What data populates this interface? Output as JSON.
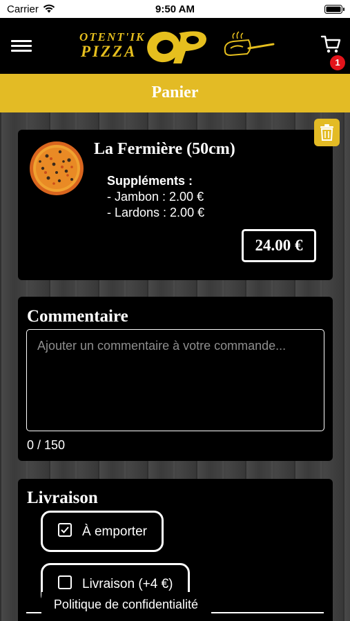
{
  "status_bar": {
    "carrier": "Carrier",
    "time": "9:50 AM"
  },
  "header": {
    "logo_line1": "OTENT'IK",
    "logo_line2": "PIZZA",
    "logo_mark": "OP",
    "cart_count": "1",
    "icons": [
      "menu-icon",
      "cart-icon",
      "pizza-peel-icon"
    ]
  },
  "title": "Panier",
  "cart_item": {
    "name": "La Fermière (50cm)",
    "supplements_label": "Suppléments :",
    "supplements": [
      "- Jambon : 2.00 €",
      "- Lardons : 2.00 €"
    ],
    "price": "24.00 €"
  },
  "comment": {
    "title": "Commentaire",
    "placeholder": "Ajouter un commentaire à votre commande...",
    "value": "",
    "counter": "0 / 150"
  },
  "delivery": {
    "title": "Livraison",
    "options": [
      {
        "label": "À emporter",
        "checked": true
      },
      {
        "label": "Livraison (+4 €)",
        "checked": false
      }
    ]
  },
  "footer": {
    "privacy_link": "Politique de confidentialité"
  },
  "colors": {
    "accent": "#e3bb25",
    "badge": "#e3141b",
    "card": "#000000",
    "text": "#ffffff"
  }
}
